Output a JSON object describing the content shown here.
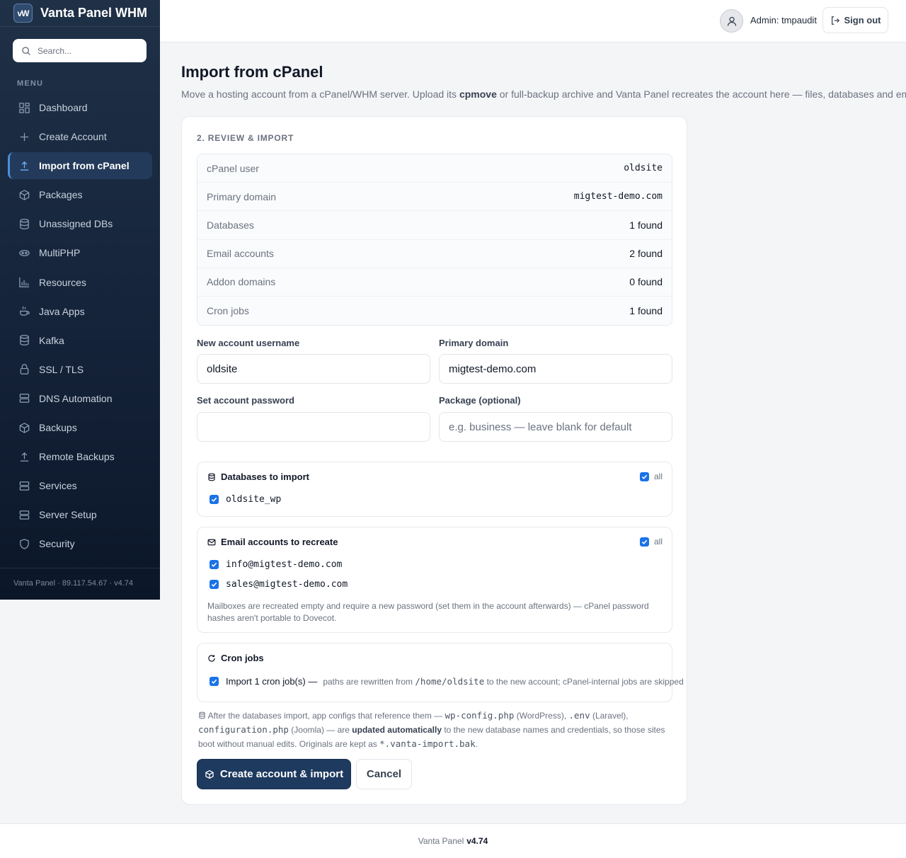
{
  "brand": {
    "logo": "vW",
    "name": "Vanta Panel WHM"
  },
  "search": {
    "placeholder": "Search..."
  },
  "sidebar": {
    "menu_label": "MENU",
    "items": [
      {
        "label": "Dashboard",
        "icon": "dashboard-icon"
      },
      {
        "label": "Create Account",
        "icon": "plus-icon"
      },
      {
        "label": "Import from cPanel",
        "icon": "upload-icon",
        "active": true
      },
      {
        "label": "Packages",
        "icon": "box-icon"
      },
      {
        "label": "Unassigned DBs",
        "icon": "database-icon"
      },
      {
        "label": "MultiPHP",
        "icon": "php-icon"
      },
      {
        "label": "Resources",
        "icon": "bar-chart-icon"
      },
      {
        "label": "Java Apps",
        "icon": "coffee-icon"
      },
      {
        "label": "Kafka",
        "icon": "database-icon"
      },
      {
        "label": "SSL / TLS",
        "icon": "lock-icon"
      },
      {
        "label": "DNS Automation",
        "icon": "server-icon"
      },
      {
        "label": "Backups",
        "icon": "box-icon"
      },
      {
        "label": "Remote Backups",
        "icon": "upload-icon"
      },
      {
        "label": "Services",
        "icon": "server-icon"
      },
      {
        "label": "Server Setup",
        "icon": "server-icon"
      },
      {
        "label": "Security",
        "icon": "shield-icon"
      }
    ],
    "footer": "Vanta Panel · 89.117.54.67 · v4.74"
  },
  "header": {
    "admin_label": "Admin: tmpaudit",
    "signout_label": "Sign out"
  },
  "page": {
    "title": "Import from cPanel",
    "subtitle_pre": "Move a hosting account from a cPanel/WHM server. Upload its ",
    "subtitle_bold": "cpmove",
    "subtitle_post": " or full-backup archive and Vanta Panel recreates the account here — files, databases and email."
  },
  "review": {
    "step_label": "2. REVIEW & IMPORT",
    "summary": [
      {
        "key": "cPanel user",
        "value": "oldsite",
        "mono": true
      },
      {
        "key": "Primary domain",
        "value": "migtest-demo.com",
        "mono": true
      },
      {
        "key": "Databases",
        "value": "1 found"
      },
      {
        "key": "Email accounts",
        "value": "2 found"
      },
      {
        "key": "Addon domains",
        "value": "0 found"
      },
      {
        "key": "Cron jobs",
        "value": "1 found"
      }
    ],
    "fields": {
      "username_label": "New account username",
      "username_value": "oldsite",
      "domain_label": "Primary domain",
      "domain_value": "migtest-demo.com",
      "password_label": "Set account password",
      "password_value": "",
      "package_label": "Package (optional)",
      "package_placeholder": "e.g. business — leave blank for default"
    },
    "databases": {
      "title": "Databases to import",
      "all_label": "all",
      "items": [
        "oldsite_wp"
      ]
    },
    "emails": {
      "title": "Email accounts to recreate",
      "all_label": "all",
      "items": [
        "info@migtest-demo.com",
        "sales@migtest-demo.com"
      ],
      "note": "Mailboxes are recreated empty and require a new password (set them in the account afterwards) — cPanel password hashes aren't portable to Dovecot."
    },
    "cron": {
      "title": "Cron jobs",
      "label": "Import 1 cron job(s) —",
      "desc_pre": "paths are rewritten from ",
      "desc_code": "/home/oldsite",
      "desc_post": " to the new account; cPanel-internal jobs are skipped"
    },
    "footnote": {
      "t1": "After the databases import, app configs that reference them — ",
      "c1": "wp-config.php",
      "t2": " (WordPress), ",
      "c2": ".env",
      "t3": " (Laravel), ",
      "c3": "configuration.php",
      "t4": " (Joomla) — are ",
      "b1": "updated automatically",
      "t5": " to the new database names and credentials, so those sites boot without manual edits. Originals are kept as ",
      "c4": "*.vanta-import.bak",
      "t6": "."
    },
    "primary_button": "Create account & import",
    "cancel_button": "Cancel"
  },
  "footer": {
    "text": "Vanta Panel",
    "version": "v4.74"
  },
  "colors": {
    "accent": "#1a73e8",
    "sidebar_bg": "#15233a",
    "primary_button": "#1e3a5f"
  }
}
